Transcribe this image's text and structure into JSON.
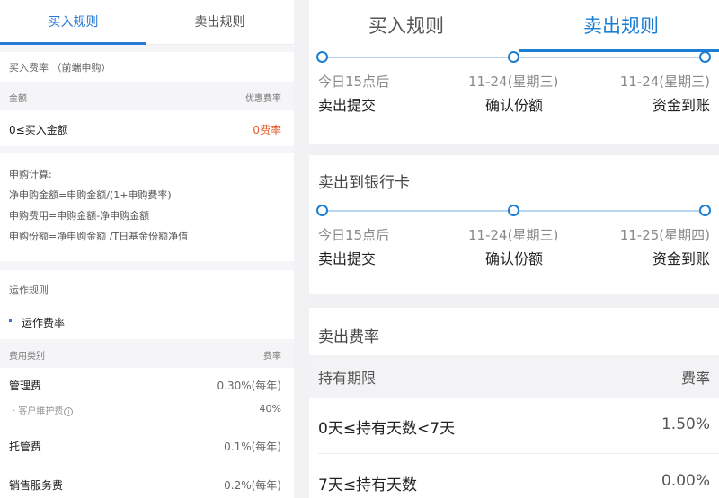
{
  "left": {
    "tabs": [
      "买入规则",
      "卖出规则"
    ],
    "buy_fee": {
      "title": "买入费率 （前端申购）",
      "columns": [
        "金额",
        "优惠费率"
      ],
      "rows": [
        {
          "amount": "0≤买入金额",
          "rate": "0费率"
        }
      ]
    },
    "calc": {
      "title": "申购计算:",
      "lines": [
        "净申购金额=申购金额/(1+申购费率)",
        "申购费用=申购金额-净申购金额",
        "申购份额=净申购金额 /T日基金份额净值"
      ]
    },
    "ops": {
      "title": "运作规则",
      "subtitle": "运作费率",
      "columns": [
        "费用类别",
        "费率"
      ],
      "rows": [
        {
          "name": "管理费",
          "rate": "0.30%(每年)"
        },
        {
          "name": "· 客户维护费",
          "info": "i",
          "rate": "40%"
        },
        {
          "name": "托管费",
          "rate": "0.1%(每年)"
        },
        {
          "name": "销售服务费",
          "rate": "0.2%(每年)"
        }
      ]
    }
  },
  "right": {
    "tabs": [
      "买入规则",
      "卖出规则"
    ],
    "timeline1": {
      "dates": [
        "今日15点后",
        "11-24(星期三)",
        "11-24(星期三)"
      ],
      "labels": [
        "卖出提交",
        "确认份额",
        "资金到账"
      ]
    },
    "bank": {
      "title": "卖出到银行卡",
      "dates": [
        "今日15点后",
        "11-24(星期三)",
        "11-25(星期四)"
      ],
      "labels": [
        "卖出提交",
        "确认份额",
        "资金到账"
      ]
    },
    "sell_fee": {
      "title": "卖出费率",
      "columns": [
        "持有期限",
        "费率"
      ],
      "rows": [
        {
          "period": "0天≤持有天数<7天",
          "rate": "1.50%"
        },
        {
          "period": "7天≤持有天数",
          "rate": "0.00%"
        }
      ]
    }
  },
  "colors": {
    "accent": "#1a7fd3",
    "fee_red": "#e35a2a"
  }
}
